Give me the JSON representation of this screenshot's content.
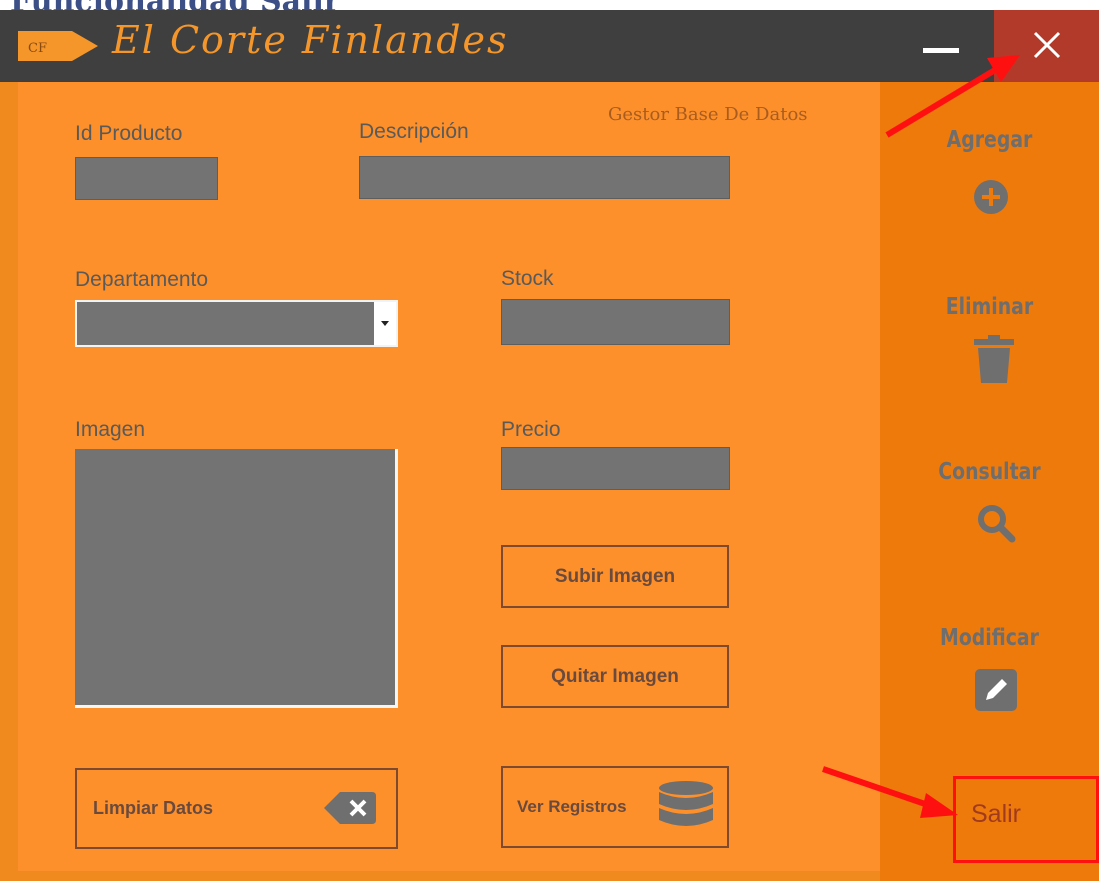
{
  "doc_heading": "Funcionalidad Salir",
  "window": {
    "logo_text": "CF",
    "title": "El Corte Finlandes",
    "subtitle": "Gestor Base De Datos",
    "minimize_icon": "minimize-icon",
    "close_icon": "close-icon"
  },
  "form": {
    "id_label": "Id Producto",
    "id_value": "",
    "desc_label": "Descripción",
    "desc_value": "",
    "dept_label": "Departamento",
    "dept_selected": "",
    "stock_label": "Stock",
    "stock_value": "",
    "image_label": "Imagen",
    "price_label": "Precio",
    "price_value": ""
  },
  "buttons": {
    "upload_image": "Subir Imagen",
    "remove_image": "Quitar Imagen",
    "clear_data": "Limpiar Datos",
    "view_records": "Ver Registros"
  },
  "sidebar": {
    "add": "Agregar",
    "delete": "Eliminar",
    "query": "Consultar",
    "modify": "Modificar",
    "exit": "Salir"
  },
  "icons": {
    "add": "plus-circle-icon",
    "delete": "trash-icon",
    "query": "search-icon",
    "modify": "edit-icon",
    "clear": "backspace-icon",
    "records": "database-icon",
    "dropdown": "chevron-down-icon"
  },
  "colors": {
    "window_bg": "#f08a1e",
    "panel_bg": "#fd902a",
    "sidebar_bg": "#ee7a0c",
    "titlebar_bg": "#3f3f3f",
    "close_bg": "#b23a2a",
    "field_bg": "#737373",
    "annotation_red": "#ff1010"
  }
}
